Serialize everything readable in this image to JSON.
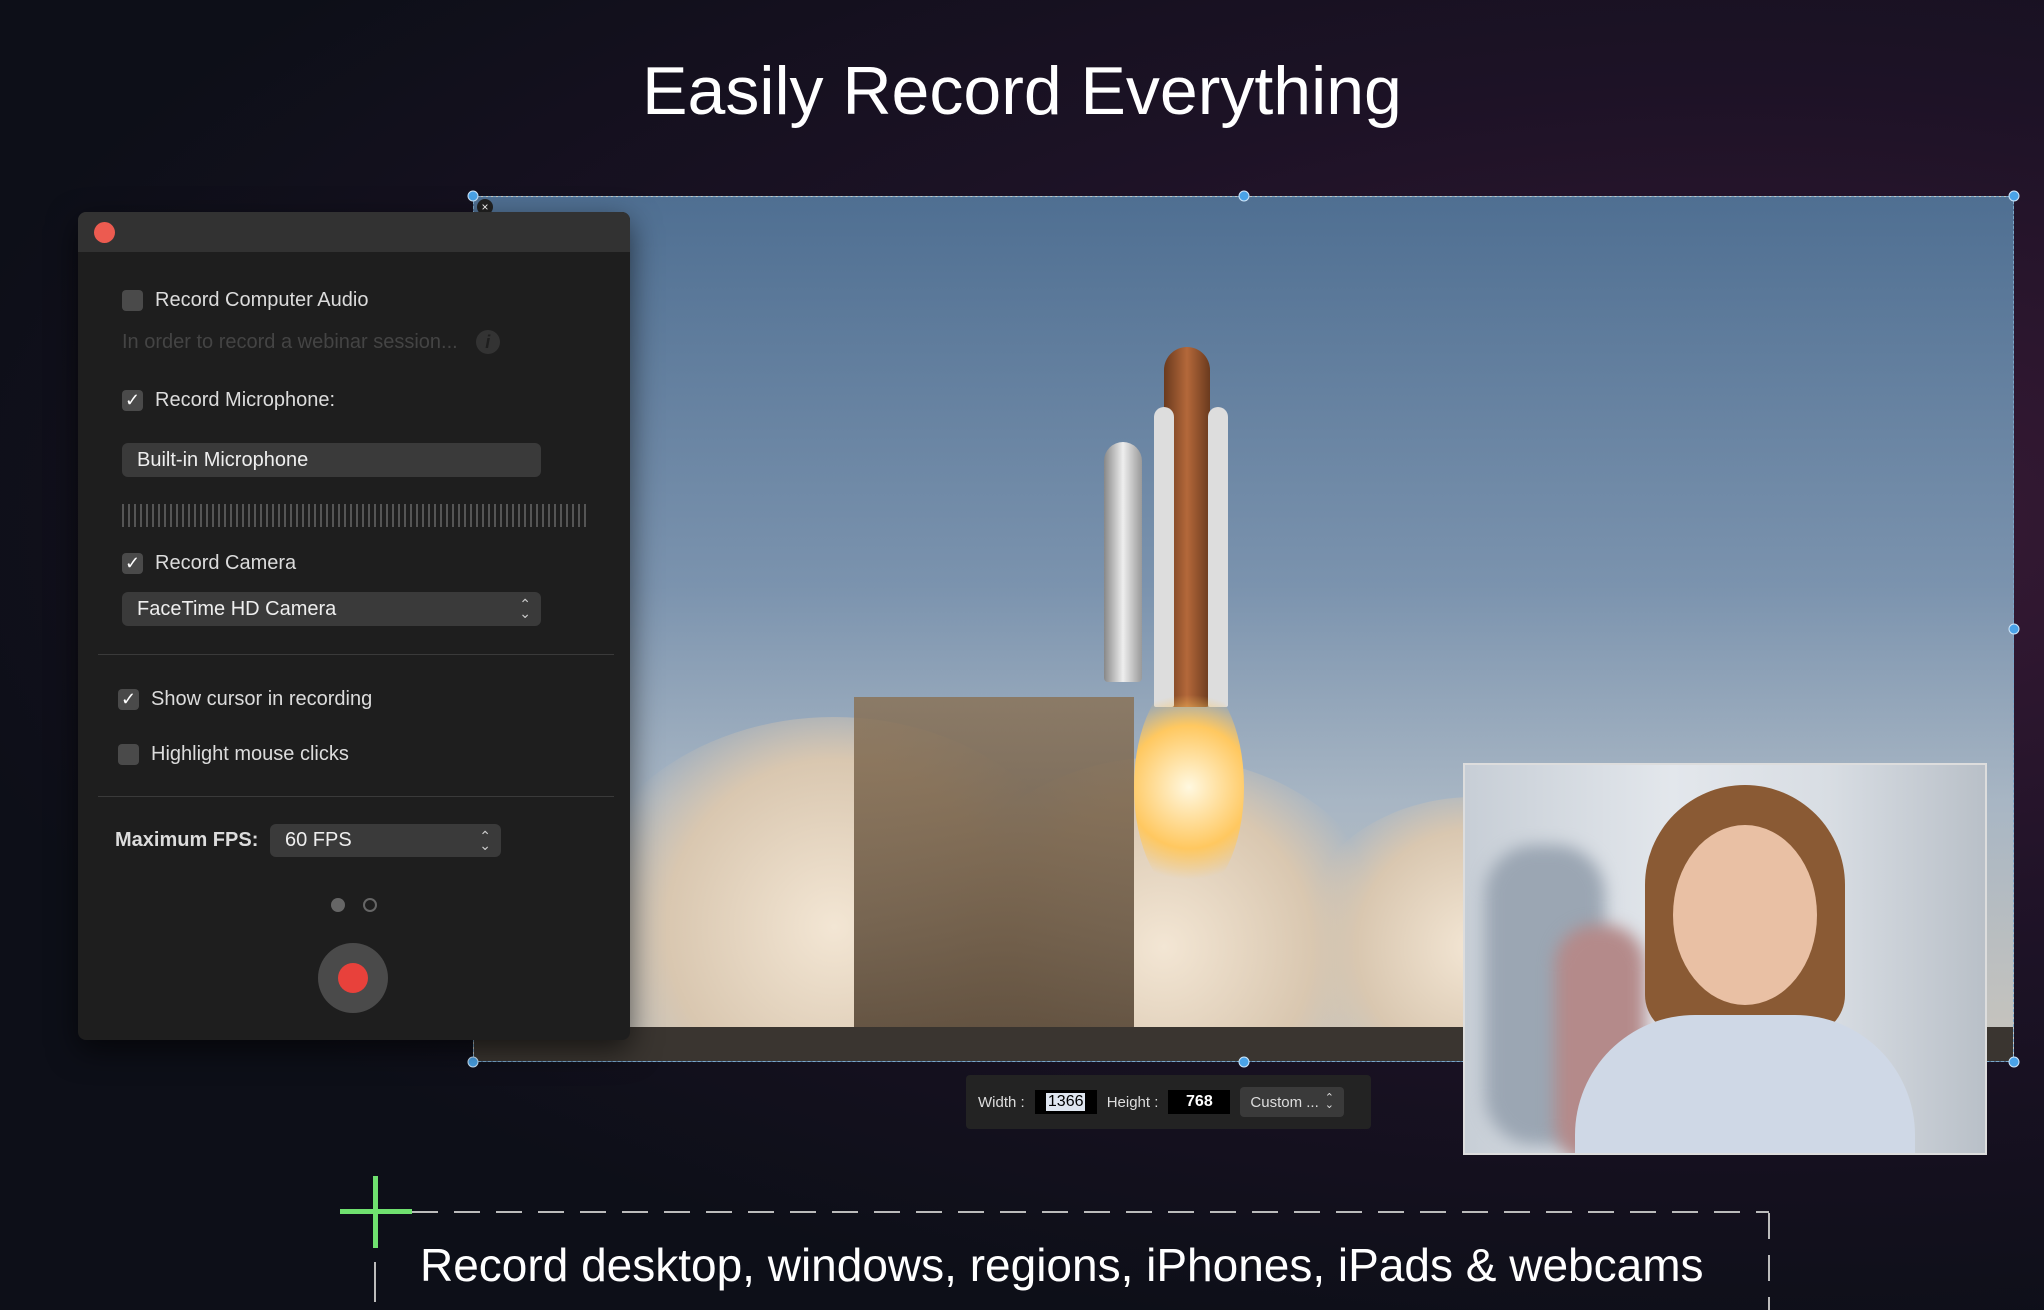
{
  "headline": "Easily Record Everything",
  "caption": "Record desktop, windows, regions, iPhones, iPads & webcams",
  "panel": {
    "record_computer_audio": {
      "label": "Record Computer Audio",
      "checked": false
    },
    "hint": "In order to record a webinar session...",
    "record_microphone": {
      "label": "Record Microphone:",
      "checked": true
    },
    "microphone_device": "Built-in Microphone",
    "record_camera": {
      "label": "Record Camera",
      "checked": true
    },
    "camera_device": "FaceTime HD Camera",
    "show_cursor": {
      "label": "Show cursor in recording",
      "checked": true
    },
    "highlight_clicks": {
      "label": "Highlight mouse clicks",
      "checked": false
    },
    "fps_label": "Maximum FPS:",
    "fps_value": "60 FPS",
    "check_glyph": "✓"
  },
  "region_toolbar": {
    "width_label": "Width :",
    "width_value": "1366",
    "height_label": "Height :",
    "height_value": "768",
    "preset": "Custom ..."
  },
  "colors": {
    "record": "#e8413b",
    "handle": "#4aa3e8",
    "cross": "#6fe06f"
  }
}
